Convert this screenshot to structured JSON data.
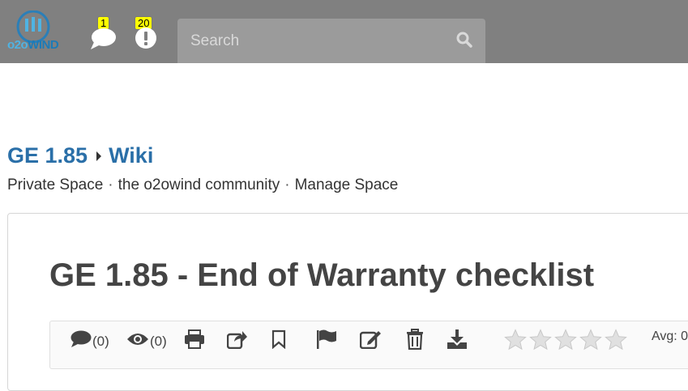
{
  "app": {
    "logo_text_o": "o2o",
    "logo_text_wind": "WIND"
  },
  "header": {
    "messages_count": "1",
    "alerts_count": "20",
    "search_placeholder": "Search"
  },
  "breadcrumb": {
    "space": "GE 1.85",
    "section": "Wiki"
  },
  "subnav": {
    "items": [
      "Private Space",
      "the o2owind community",
      "Manage Space"
    ],
    "separator": "·"
  },
  "article": {
    "title": "GE 1.85 - End of Warranty checklist"
  },
  "toolbar": {
    "comments_count": "(0)",
    "views_count": "(0)",
    "rating_stars": 5,
    "rating_value": 0,
    "avg_label": "Avg: 0"
  },
  "colors": {
    "topbar": "#808080",
    "link": "#2a6fa8",
    "badge": "#ffff00"
  }
}
